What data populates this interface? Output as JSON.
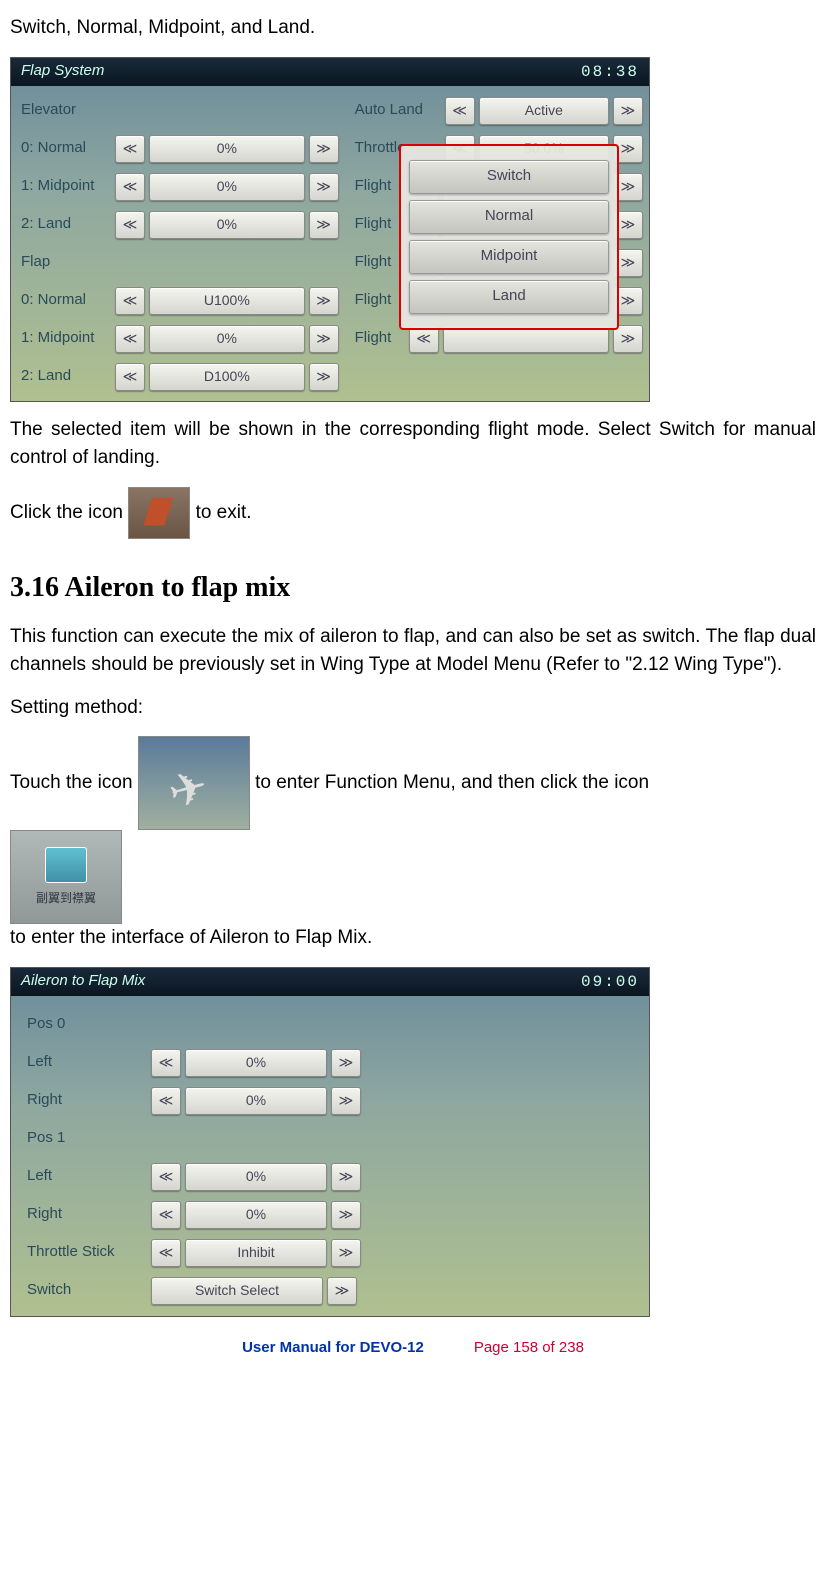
{
  "intro_fragment": "Switch, Normal, Midpoint, and Land.",
  "flap_screenshot": {
    "title": "Flap System",
    "time": "08:38",
    "elevator_header": "Elevator",
    "elevator_rows": [
      {
        "label": "0: Normal",
        "value": "0%"
      },
      {
        "label": "1: Midpoint",
        "value": "0%"
      },
      {
        "label": "2: Land",
        "value": "0%"
      }
    ],
    "flap_header": "Flap",
    "flap_rows": [
      {
        "label": "0: Normal",
        "value": "U100%"
      },
      {
        "label": "1: Midpoint",
        "value": "0%"
      },
      {
        "label": "2: Land",
        "value": "D100%"
      }
    ],
    "right_rows": [
      {
        "label": "Auto Land",
        "value": "Active"
      },
      {
        "label": "Throttle",
        "value": "50.0%"
      },
      {
        "label": "Flight",
        "value": ""
      },
      {
        "label": "Flight",
        "value": ""
      },
      {
        "label": "Flight",
        "value": ""
      },
      {
        "label": "Flight",
        "value": ""
      },
      {
        "label": "Flight",
        "value": ""
      }
    ],
    "popup_options": [
      "Switch",
      "Normal",
      "Midpoint",
      "Land"
    ]
  },
  "para_after_flap": "The selected item will be shown in the corresponding flight mode. Select Switch for manual control of landing.",
  "click_icon_before": "Click the icon ",
  "click_icon_after": " to exit.",
  "section_heading": "3.16 Aileron to flap mix",
  "section_para": "This function can execute the mix of aileron to flap, and can also be set as switch. The flap dual channels should be previously set in Wing Type at Model Menu (Refer to \"2.12 Wing Type\").",
  "setting_method_label": "Setting method:",
  "touch_icon_before": "Touch the icon ",
  "touch_icon_mid": " to enter Function Menu, and then click the icon ",
  "touch_icon_after": " to enter the interface of Aileron to Flap Mix.",
  "menu_icon_caption": "副翼到襟翼",
  "aileron_screenshot": {
    "title": "Aileron to Flap Mix",
    "time": "09:00",
    "groups": [
      {
        "header": "Pos 0",
        "rows": [
          {
            "label": "Left",
            "value": "0%"
          },
          {
            "label": "Right",
            "value": "0%"
          }
        ]
      },
      {
        "header": "Pos 1",
        "rows": [
          {
            "label": "Left",
            "value": "0%"
          },
          {
            "label": "Right",
            "value": "0%"
          }
        ]
      }
    ],
    "throttle_row": {
      "label": "Throttle Stick",
      "value": "Inhibit"
    },
    "switch_row": {
      "label": "Switch",
      "value": "Switch Select"
    }
  },
  "footer": {
    "left": "User Manual for DEVO-12",
    "right": "Page 158 of 238"
  }
}
